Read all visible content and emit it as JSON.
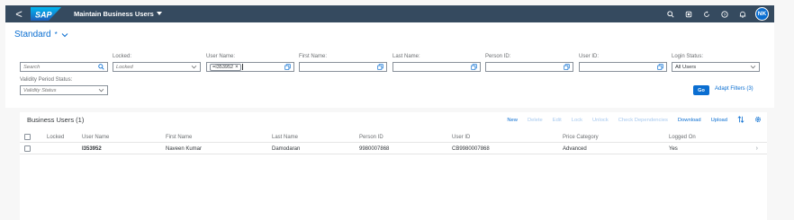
{
  "shell": {
    "back_label": "<",
    "logo_text": "SAP",
    "app_title": "Maintain Business Users",
    "avatar_initials": "NK"
  },
  "filter": {
    "variant_name": "Standard",
    "variant_modified": "*",
    "search_placeholder": "Search",
    "locked_label": "Locked:",
    "locked_placeholder": "Locked",
    "username_label": "User Name:",
    "username_token": "=I353952",
    "firstname_label": "First Name:",
    "lastname_label": "Last Name:",
    "personid_label": "Person ID:",
    "userid_label": "User ID:",
    "loginstatus_label": "Login Status:",
    "loginstatus_value": "All Users",
    "validity_label": "Validity Period Status:",
    "validity_placeholder": "Validity Status",
    "go_label": "Go",
    "adapt_label": "Adapt Filters (3)"
  },
  "table": {
    "title": "Business Users (1)",
    "toolbar": [
      {
        "label": "New",
        "enabled": true
      },
      {
        "label": "Delete",
        "enabled": false
      },
      {
        "label": "Edit",
        "enabled": false
      },
      {
        "label": "Lock",
        "enabled": false
      },
      {
        "label": "Unlock",
        "enabled": false
      },
      {
        "label": "Check Dependencies",
        "enabled": false
      },
      {
        "label": "Download",
        "enabled": true
      },
      {
        "label": "Upload",
        "enabled": true
      }
    ],
    "columns": {
      "locked": "Locked",
      "username": "User Name",
      "firstname": "First Name",
      "lastname": "Last Name",
      "personid": "Person ID",
      "userid": "User ID",
      "pricecat": "Price Category",
      "loggedon": "Logged On"
    },
    "rows": [
      {
        "username": "I353952",
        "firstname": "Naveen Kumar",
        "lastname": "Damodaran",
        "personid": "9980007868",
        "userid": "CB9980007868",
        "pricecat": "Advanced",
        "loggedon": "Yes"
      }
    ]
  }
}
